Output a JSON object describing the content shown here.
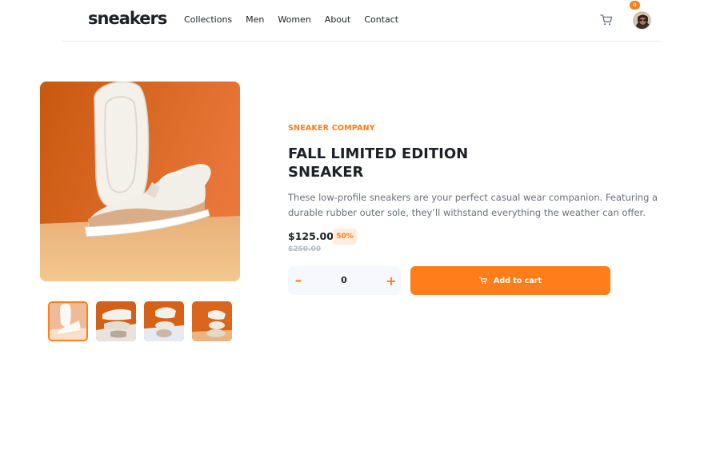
{
  "header": {
    "logo": "sneakers",
    "nav": [
      "Collections",
      "Men",
      "Women",
      "About",
      "Contact"
    ],
    "cart_count": "0",
    "icons": {
      "cart": "cart-icon",
      "avatar": "user-avatar"
    }
  },
  "gallery": {
    "main": "shoe-photo-1",
    "thumbnails": [
      "shoe-photo-1",
      "shoe-photo-2",
      "shoe-photo-3",
      "shoe-photo-4"
    ],
    "active_index": 0
  },
  "product": {
    "company": "SNEAKER COMPANY",
    "title_line1": "FALL LIMITED EDITION",
    "title_line2": "SNEAKER",
    "description": "These low-profile sneakers are your perfect casual wear companion. Featuring a durable rubber outer sole, they’ll withstand everything the weather can offer.",
    "price": "$125.00",
    "discount": "50%",
    "original_price": "$250.00"
  },
  "cart_controls": {
    "minus": "–",
    "quantity": "0",
    "plus": "+",
    "add_label": "Add to cart"
  },
  "colors": {
    "accent": "#ff7e1b",
    "accent_pale": "#ffede0",
    "text_dark": "#1d2025",
    "text_gray": "#68707d",
    "strike_gray": "#b6bcc8"
  }
}
